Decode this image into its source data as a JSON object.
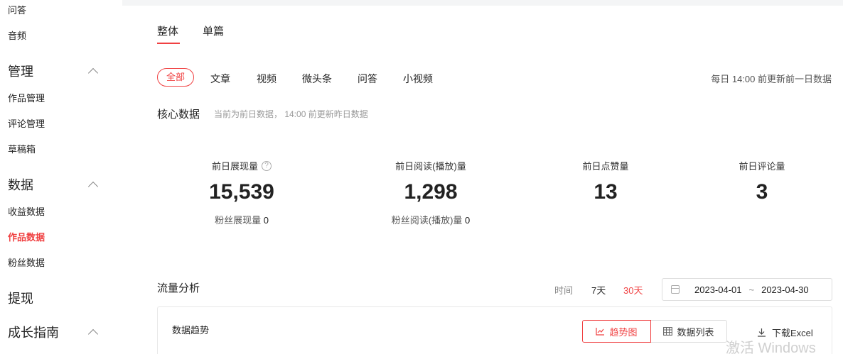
{
  "sidebar": {
    "items": [
      {
        "label": "问答"
      },
      {
        "label": "音频"
      }
    ],
    "groups": [
      {
        "label": "管理",
        "items": [
          {
            "label": "作品管理"
          },
          {
            "label": "评论管理"
          },
          {
            "label": "草稿箱"
          }
        ]
      },
      {
        "label": "数据",
        "items": [
          {
            "label": "收益数据"
          },
          {
            "label": "作品数据",
            "active": true
          },
          {
            "label": "粉丝数据"
          }
        ]
      },
      {
        "label": "提现"
      },
      {
        "label": "成长指南"
      }
    ]
  },
  "tabs": [
    {
      "label": "整体",
      "active": true
    },
    {
      "label": "单篇"
    }
  ],
  "filters": [
    "全部",
    "文章",
    "视频",
    "微头条",
    "问答",
    "小视频"
  ],
  "update_note": "每日 14:00 前更新前一日数据",
  "core": {
    "title": "核心数据",
    "subtitle": "当前为前日数据， 14:00 前更新昨日数据",
    "stats": [
      {
        "label": "前日展现量",
        "value": "15,539",
        "sub_label": "粉丝展现量",
        "sub_value": "0"
      },
      {
        "label": "前日阅读(播放)量",
        "value": "1,298",
        "sub_label": "粉丝阅读(播放)量",
        "sub_value": "0"
      },
      {
        "label": "前日点赞量",
        "value": "13"
      },
      {
        "label": "前日评论量",
        "value": "3"
      }
    ]
  },
  "traffic": {
    "title": "流量分析",
    "time_label": "时间",
    "ranges": [
      {
        "label": "7天"
      },
      {
        "label": "30天",
        "active": true
      }
    ],
    "date_start": "2023-04-01",
    "date_sep": "~",
    "date_end": "2023-04-30"
  },
  "trend": {
    "title": "数据趋势",
    "chart_button": "趋势图",
    "list_button": "数据列表",
    "download": "下载Excel"
  },
  "watermark": "激活 Windows",
  "colors": {
    "accent": "#f04142",
    "background": "#f4f5f6"
  }
}
